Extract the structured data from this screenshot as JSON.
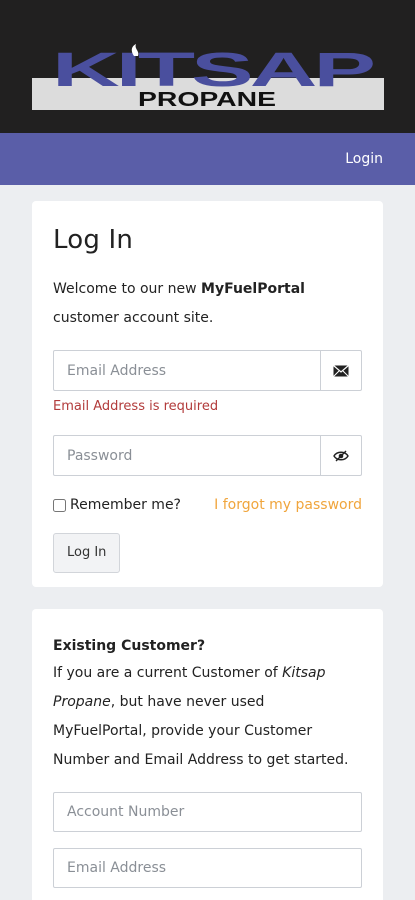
{
  "header": {
    "logo_main": "KITSAP",
    "logo_sub": "PROPANE"
  },
  "nav": {
    "login_label": "Login"
  },
  "login_card": {
    "title": "Log In",
    "welcome_prefix": "Welcome to our new ",
    "welcome_brand": "MyFuelPortal",
    "welcome_suffix": " customer account site.",
    "email_placeholder": "Email Address",
    "email_error": "Email Address is required",
    "password_placeholder": "Password",
    "remember_label": "Remember me?",
    "forgot_label": "I forgot my password",
    "login_button": "Log In"
  },
  "existing_card": {
    "title": "Existing Customer?",
    "text_1": "If you are a current Customer of ",
    "text_company": "Kitsap Propane",
    "text_2": ", but have never used MyFuelPortal, provide your Customer Number and Email Address to get started.",
    "account_placeholder": "Account Number",
    "email_placeholder": "Email Address"
  },
  "colors": {
    "header_bg": "#212020",
    "nav_bg": "#5a5ea8",
    "logo_blue": "#4a4f9e",
    "error": "#b23b3b",
    "link_orange": "#f0a53c"
  },
  "icons": {
    "email_addon": "envelope-icon",
    "password_addon": "eye-slash-icon"
  }
}
